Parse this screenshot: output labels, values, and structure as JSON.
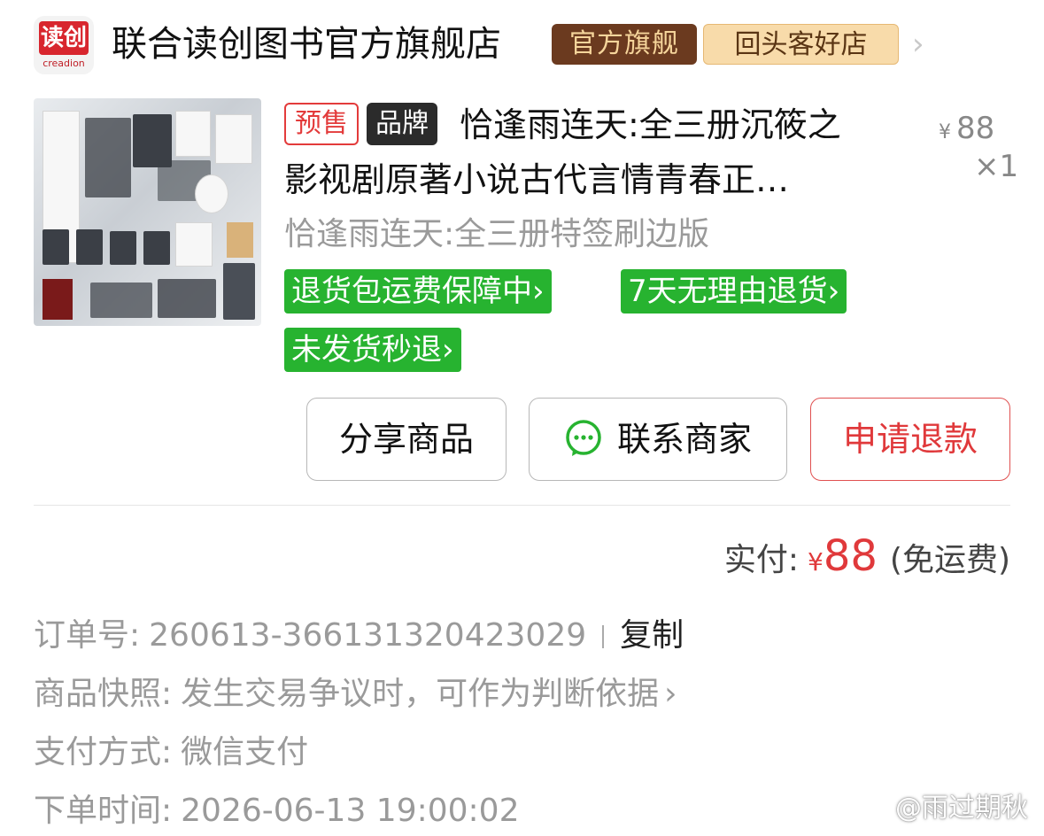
{
  "store": {
    "logo_text": "读创",
    "logo_subtext": "creadion",
    "name": "联合读创图书官方旗舰店",
    "badge_official": "官方旗舰",
    "badge_repeat": "回头客好店"
  },
  "product": {
    "tag_presale": "预售",
    "tag_brand": "品牌",
    "title_line1": "恰逢雨连天:全三册沉筱之",
    "title_line2": "影视剧原著小说古代言情青春正…",
    "price_symbol": "¥",
    "price": "88",
    "quantity": "×1",
    "sku": "恰逢雨连天:全三册特签刷边版",
    "services": [
      "退货包运费保障中",
      "7天无理由退货",
      "未发货秒退"
    ]
  },
  "actions": {
    "share": "分享商品",
    "contact": "联系商家",
    "refund": "申请退款"
  },
  "payment": {
    "label": "实付:",
    "symbol": "¥",
    "amount": "88",
    "shipping_note": "(免运费)"
  },
  "order": {
    "number_label": "订单号:",
    "number": "260613-366131320423029",
    "copy": "复制",
    "snapshot_label": "商品快照:",
    "snapshot_value": "发生交易争议时，可作为判断依据",
    "payment_method_label": "支付方式:",
    "payment_method": "微信支付",
    "order_time_label": "下单时间:",
    "order_time": "2026-06-13 19:00:02"
  },
  "watermark": "@雨过期秋",
  "colors": {
    "accent_red": "#e0393b",
    "service_green": "#27b330",
    "official_badge": "#6b3a1f",
    "repeat_badge": "#f8dbaa"
  }
}
